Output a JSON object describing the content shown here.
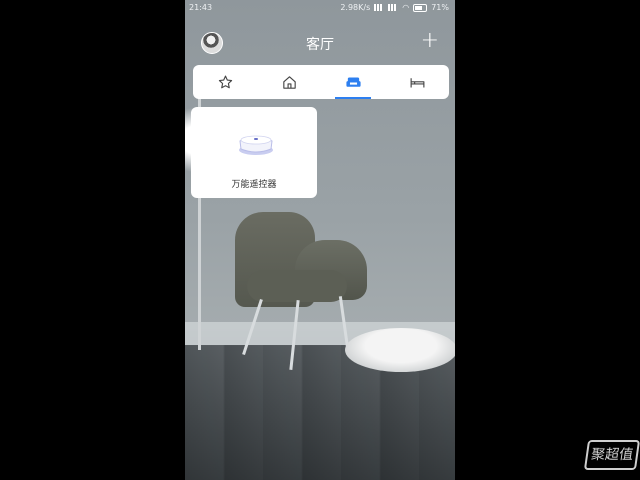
{
  "status_bar": {
    "time": "21:43",
    "network_speed": "2.98K/s",
    "battery": "71%"
  },
  "header": {
    "title": "客厅"
  },
  "tabs": [
    {
      "icon": "star-icon",
      "active": false
    },
    {
      "icon": "home-icon",
      "active": false
    },
    {
      "icon": "sofa-icon",
      "active": true
    },
    {
      "icon": "bed-icon",
      "active": false
    }
  ],
  "devices": [
    {
      "label": "万能遥控器",
      "icon": "remote-hub-icon"
    }
  ],
  "colors": {
    "accent": "#2d7ff0"
  },
  "watermark": {
    "text": "聚超值"
  }
}
